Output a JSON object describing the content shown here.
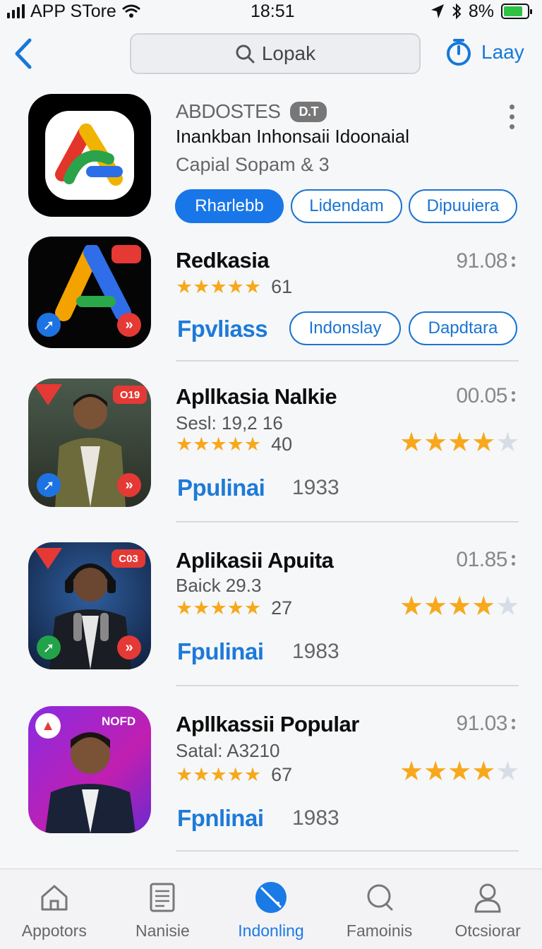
{
  "status": {
    "carrier": "APP STore",
    "time": "18:51",
    "battery": "8%",
    "battery_level": 0.8
  },
  "nav": {
    "search_text": "Lopak",
    "right_label": "Laay"
  },
  "featured": {
    "name": "ABDOSTES",
    "badge": "D.T",
    "description": "Inankban Inhonsaii Idoonaial",
    "subtitle": "Capial Sopam & 3",
    "buttons": [
      "Rharlebb",
      "Lidendam",
      "Dipuuiera"
    ]
  },
  "apps": [
    {
      "title": "Redkasia",
      "rating_count": "61",
      "score": "91.08",
      "link": "Fpvliass",
      "buttons": [
        "Indonslay",
        "Dapdtara"
      ],
      "stars": 5
    },
    {
      "title": "Apllkasia Nalkie",
      "subtitle": "Sesl: 19,2 16",
      "rating_count": "40",
      "score": "00.05",
      "link": "Ppulinai",
      "number": "1933",
      "stars": 5,
      "right_stars": 4,
      "badge": "O19"
    },
    {
      "title": "Aplikasii Apuita",
      "subtitle": "Baick 29.3",
      "rating_count": "27",
      "score": "01.85",
      "link": "Fpulinai",
      "number": "1983",
      "stars": 5,
      "right_stars": 4,
      "badge": "C03"
    },
    {
      "title": "Apllkassii Popular",
      "subtitle": "Satal: A3210",
      "rating_count": "67",
      "score": "91.03",
      "link": "Fpnlinai",
      "number": "1983",
      "stars": 5,
      "right_stars": 4,
      "badge": "NOFD"
    }
  ],
  "tabs": [
    {
      "label": "Appotors",
      "icon": "home-icon"
    },
    {
      "label": "Nanisie",
      "icon": "document-icon"
    },
    {
      "label": "Indonling",
      "icon": "compass-icon",
      "active": true
    },
    {
      "label": "Famoinis",
      "icon": "chat-icon"
    },
    {
      "label": "Otcsiorar",
      "icon": "person-icon"
    }
  ],
  "colors": {
    "accent": "#1876e8",
    "star": "#f7a81b",
    "star_empty": "#d7dde6"
  }
}
